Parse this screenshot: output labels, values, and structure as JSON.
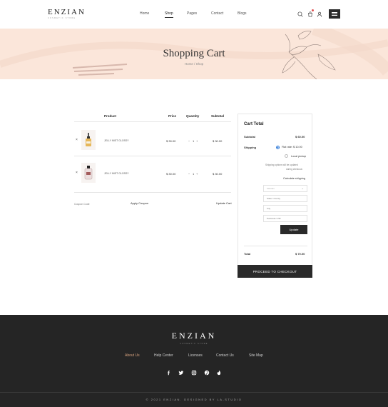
{
  "header": {
    "logo": "ENZIAN",
    "logo_sub": "COSMETIC STORE",
    "nav": [
      "Home",
      "Shop",
      "Pages",
      "Contact",
      "Blogs"
    ]
  },
  "banner": {
    "title": "Shopping Cart",
    "breadcrumb": "Home / Shop"
  },
  "cart": {
    "columns": [
      "Product",
      "Price",
      "Quantity",
      "Subtotal"
    ],
    "rows": [
      {
        "remove": "×",
        "name": "JELLY MIST GLOSSY",
        "price": "$ 30.00",
        "qty": "1",
        "subtotal": "$ 30.00"
      },
      {
        "remove": "×",
        "name": "JELLY MIST GLOSSY",
        "price": "$ 30.00",
        "qty": "1",
        "subtotal": "$ 30.00"
      }
    ],
    "coupon_placeholder": "Coupon Code",
    "apply_coupon": "Apply Coupon",
    "update_cart": "Update Cart"
  },
  "totals": {
    "title": "Cart Total",
    "subtotal_label": "Subtotal",
    "subtotal_value": "$ 60.00",
    "shipping_label": "Shipping",
    "flat_rate": "Flat rate: $ 10.00",
    "local_pickup": "Local pickup",
    "shipping_note_1": "Shipping options will be updated",
    "shipping_note_2": "during checkout.",
    "calc_shipping": "Calculate shipping",
    "country_placeholder": "Vietnam",
    "state_placeholder": "State / County",
    "city_placeholder": "City",
    "postcode_placeholder": "Postcode / ZIP",
    "update_btn": "Update",
    "total_label": "Total",
    "total_value": "$ 70.00",
    "checkout_btn": "PROCEED TO CHECKOUT"
  },
  "footer": {
    "logo": "ENZIAN",
    "logo_sub": "COSMETIC STORE",
    "links": [
      "About Us",
      "Help Center",
      "Licenses",
      "Contact Us",
      "Site Map"
    ],
    "social": [
      "facebook-icon",
      "twitter-icon",
      "instagram-icon",
      "pinterest-icon",
      "dribbble-icon"
    ],
    "copyright": "© 2021 ENZIAN. DESIGNED BY LA-STUDIO"
  },
  "colors": {
    "banner_bg": "#fbe6da",
    "dark": "#2a2a2a",
    "footer_bg": "#252525",
    "accent_link": "#d5a07d",
    "radio_on": "#2f7ad8",
    "notification": "#e04f4f"
  }
}
